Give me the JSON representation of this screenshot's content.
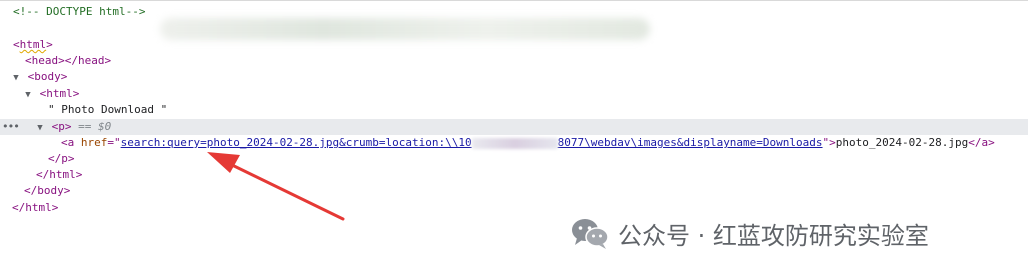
{
  "devtools": {
    "comment": "<!-- DOCTYPE html-->",
    "html_open": "html",
    "head_open": "head",
    "head_close": "/head",
    "body_open": "body",
    "inner_html_open": "html",
    "text_node": "\" Photo Download \"",
    "p_open": "p",
    "selected_marker": "== $0",
    "a_open": "a",
    "href_attr_name": "href",
    "href_value_prefix": "search:query=photo_2024-02-28.jpg&crumb=location:\\\\10",
    "href_value_suffix": "8077\\webdav\\images&displayname=Downloads",
    "link_text": "photo_2024-02-28.jpg",
    "a_close": "/a",
    "p_close": "/p",
    "inner_html_close": "/html",
    "body_close": "/body",
    "html_close": "/html"
  },
  "watermark": {
    "text": "公众号 · 红蓝攻防研究实验室"
  },
  "colors": {
    "tag": "#881280",
    "attr_name": "#994500",
    "attr_value": "#1a1aa6",
    "comment": "#236e25",
    "arrow": "#e53935",
    "selected_row": "#e8eaed"
  },
  "icons": {
    "expand": "triangle-down-icon",
    "more": "ellipsis-icon",
    "logo": "wechat-icon"
  }
}
